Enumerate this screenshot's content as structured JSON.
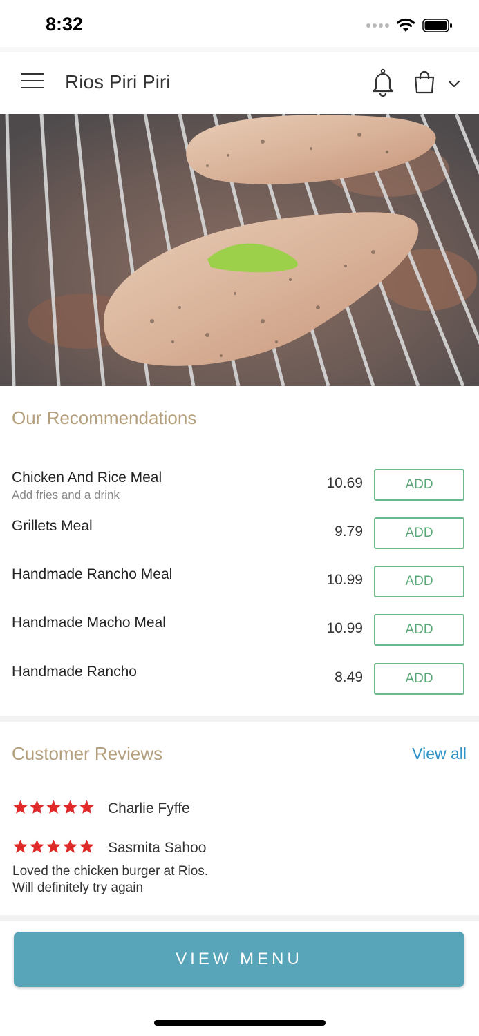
{
  "status_bar": {
    "time": "8:32"
  },
  "header": {
    "title": "Rios Piri Piri"
  },
  "hero": {
    "image_alt": "grilled-chicken"
  },
  "recommendations": {
    "title": "Our Recommendations",
    "add_label": "ADD",
    "items": [
      {
        "name": "Chicken And Rice Meal",
        "desc": "Add fries and a drink",
        "price": "10.69"
      },
      {
        "name": "Grillets Meal",
        "desc": "",
        "price": "9.79"
      },
      {
        "name": "Handmade Rancho Meal",
        "desc": "",
        "price": "10.99"
      },
      {
        "name": "Handmade Macho Meal",
        "desc": "",
        "price": "10.99"
      },
      {
        "name": "Handmade Rancho",
        "desc": "",
        "price": "8.49"
      }
    ]
  },
  "reviews": {
    "title": "Customer Reviews",
    "view_all": "View all",
    "items": [
      {
        "name": "Charlie Fyffe",
        "rating": 5,
        "text": ""
      },
      {
        "name": "Sasmita Sahoo",
        "rating": 5,
        "text": "Loved the chicken burger at Rios.\nWill definitely try again"
      }
    ]
  },
  "footer": {
    "button_label": "VIEW MENU"
  },
  "colors": {
    "accent_title": "#b5a07e",
    "add_green": "#5aa877",
    "link_blue": "#2f93c7",
    "button_teal": "#58a4b9",
    "star_red": "#e02a2a"
  }
}
